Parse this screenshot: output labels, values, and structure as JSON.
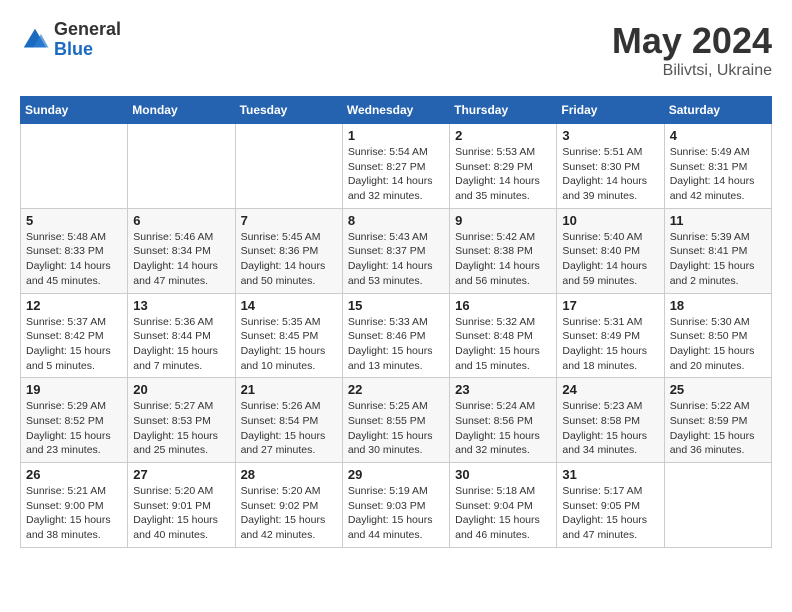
{
  "header": {
    "logo_general": "General",
    "logo_blue": "Blue",
    "month": "May 2024",
    "location": "Bilivtsi, Ukraine"
  },
  "days_of_week": [
    "Sunday",
    "Monday",
    "Tuesday",
    "Wednesday",
    "Thursday",
    "Friday",
    "Saturday"
  ],
  "weeks": [
    [
      {
        "day": "",
        "info": ""
      },
      {
        "day": "",
        "info": ""
      },
      {
        "day": "",
        "info": ""
      },
      {
        "day": "1",
        "info": "Sunrise: 5:54 AM\nSunset: 8:27 PM\nDaylight: 14 hours\nand 32 minutes."
      },
      {
        "day": "2",
        "info": "Sunrise: 5:53 AM\nSunset: 8:29 PM\nDaylight: 14 hours\nand 35 minutes."
      },
      {
        "day": "3",
        "info": "Sunrise: 5:51 AM\nSunset: 8:30 PM\nDaylight: 14 hours\nand 39 minutes."
      },
      {
        "day": "4",
        "info": "Sunrise: 5:49 AM\nSunset: 8:31 PM\nDaylight: 14 hours\nand 42 minutes."
      }
    ],
    [
      {
        "day": "5",
        "info": "Sunrise: 5:48 AM\nSunset: 8:33 PM\nDaylight: 14 hours\nand 45 minutes."
      },
      {
        "day": "6",
        "info": "Sunrise: 5:46 AM\nSunset: 8:34 PM\nDaylight: 14 hours\nand 47 minutes."
      },
      {
        "day": "7",
        "info": "Sunrise: 5:45 AM\nSunset: 8:36 PM\nDaylight: 14 hours\nand 50 minutes."
      },
      {
        "day": "8",
        "info": "Sunrise: 5:43 AM\nSunset: 8:37 PM\nDaylight: 14 hours\nand 53 minutes."
      },
      {
        "day": "9",
        "info": "Sunrise: 5:42 AM\nSunset: 8:38 PM\nDaylight: 14 hours\nand 56 minutes."
      },
      {
        "day": "10",
        "info": "Sunrise: 5:40 AM\nSunset: 8:40 PM\nDaylight: 14 hours\nand 59 minutes."
      },
      {
        "day": "11",
        "info": "Sunrise: 5:39 AM\nSunset: 8:41 PM\nDaylight: 15 hours\nand 2 minutes."
      }
    ],
    [
      {
        "day": "12",
        "info": "Sunrise: 5:37 AM\nSunset: 8:42 PM\nDaylight: 15 hours\nand 5 minutes."
      },
      {
        "day": "13",
        "info": "Sunrise: 5:36 AM\nSunset: 8:44 PM\nDaylight: 15 hours\nand 7 minutes."
      },
      {
        "day": "14",
        "info": "Sunrise: 5:35 AM\nSunset: 8:45 PM\nDaylight: 15 hours\nand 10 minutes."
      },
      {
        "day": "15",
        "info": "Sunrise: 5:33 AM\nSunset: 8:46 PM\nDaylight: 15 hours\nand 13 minutes."
      },
      {
        "day": "16",
        "info": "Sunrise: 5:32 AM\nSunset: 8:48 PM\nDaylight: 15 hours\nand 15 minutes."
      },
      {
        "day": "17",
        "info": "Sunrise: 5:31 AM\nSunset: 8:49 PM\nDaylight: 15 hours\nand 18 minutes."
      },
      {
        "day": "18",
        "info": "Sunrise: 5:30 AM\nSunset: 8:50 PM\nDaylight: 15 hours\nand 20 minutes."
      }
    ],
    [
      {
        "day": "19",
        "info": "Sunrise: 5:29 AM\nSunset: 8:52 PM\nDaylight: 15 hours\nand 23 minutes."
      },
      {
        "day": "20",
        "info": "Sunrise: 5:27 AM\nSunset: 8:53 PM\nDaylight: 15 hours\nand 25 minutes."
      },
      {
        "day": "21",
        "info": "Sunrise: 5:26 AM\nSunset: 8:54 PM\nDaylight: 15 hours\nand 27 minutes."
      },
      {
        "day": "22",
        "info": "Sunrise: 5:25 AM\nSunset: 8:55 PM\nDaylight: 15 hours\nand 30 minutes."
      },
      {
        "day": "23",
        "info": "Sunrise: 5:24 AM\nSunset: 8:56 PM\nDaylight: 15 hours\nand 32 minutes."
      },
      {
        "day": "24",
        "info": "Sunrise: 5:23 AM\nSunset: 8:58 PM\nDaylight: 15 hours\nand 34 minutes."
      },
      {
        "day": "25",
        "info": "Sunrise: 5:22 AM\nSunset: 8:59 PM\nDaylight: 15 hours\nand 36 minutes."
      }
    ],
    [
      {
        "day": "26",
        "info": "Sunrise: 5:21 AM\nSunset: 9:00 PM\nDaylight: 15 hours\nand 38 minutes."
      },
      {
        "day": "27",
        "info": "Sunrise: 5:20 AM\nSunset: 9:01 PM\nDaylight: 15 hours\nand 40 minutes."
      },
      {
        "day": "28",
        "info": "Sunrise: 5:20 AM\nSunset: 9:02 PM\nDaylight: 15 hours\nand 42 minutes."
      },
      {
        "day": "29",
        "info": "Sunrise: 5:19 AM\nSunset: 9:03 PM\nDaylight: 15 hours\nand 44 minutes."
      },
      {
        "day": "30",
        "info": "Sunrise: 5:18 AM\nSunset: 9:04 PM\nDaylight: 15 hours\nand 46 minutes."
      },
      {
        "day": "31",
        "info": "Sunrise: 5:17 AM\nSunset: 9:05 PM\nDaylight: 15 hours\nand 47 minutes."
      },
      {
        "day": "",
        "info": ""
      }
    ]
  ]
}
